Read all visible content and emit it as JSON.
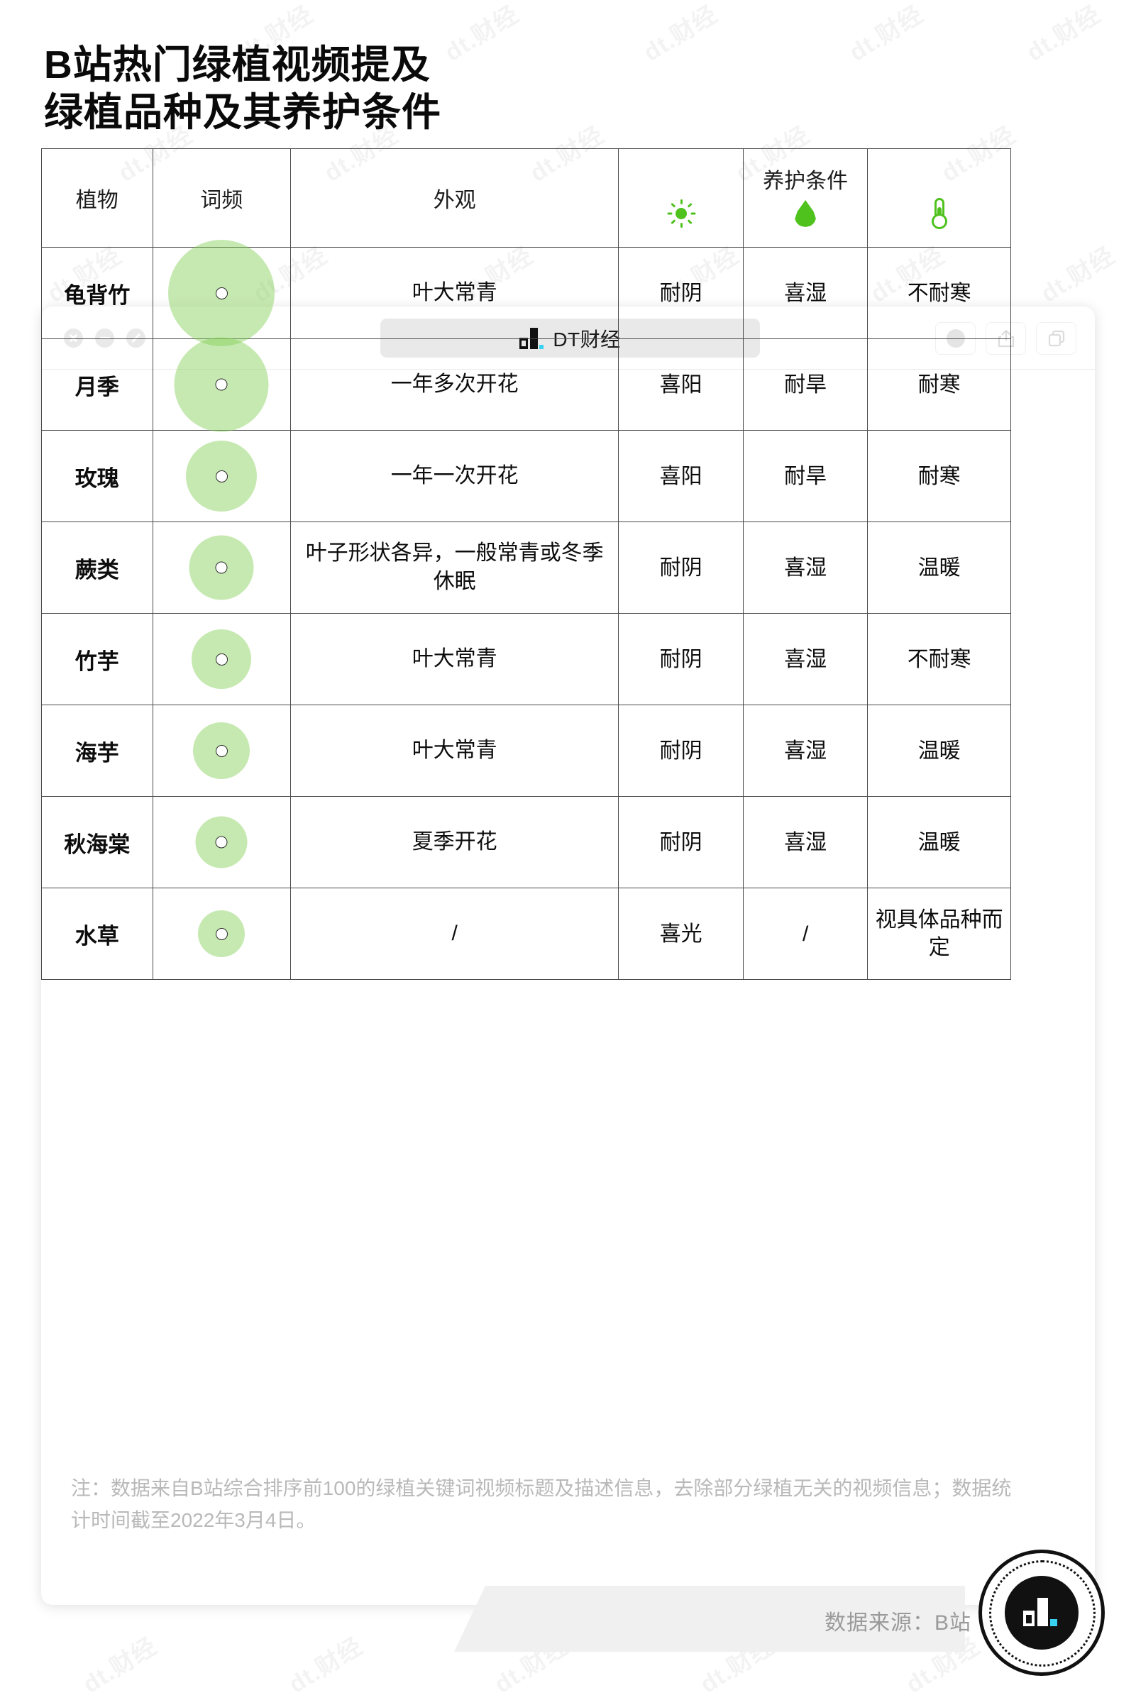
{
  "title": {
    "line1": "B站热门绿植视频提及",
    "line2": "绿植品种及其养护条件"
  },
  "browser": {
    "tab_label": "DT财经",
    "window_controls": [
      "close",
      "minimize",
      "maximize"
    ],
    "right_controls": [
      "record-button",
      "share-button",
      "tabs-button"
    ]
  },
  "table": {
    "headers": {
      "plant": "植物",
      "frequency": "词频",
      "appearance": "外观",
      "care_group": "养护条件",
      "care_sun": "sun-icon",
      "care_water": "water-drop-icon",
      "care_temp": "thermometer-icon"
    },
    "rows": [
      {
        "plant": "龟背竹",
        "freq_size": 150,
        "appearance": "叶大常青",
        "light": "耐阴",
        "water": "喜湿",
        "temp": "不耐寒"
      },
      {
        "plant": "月季",
        "freq_size": 133,
        "appearance": "一年多次开花",
        "light": "喜阳",
        "water": "耐旱",
        "temp": "耐寒"
      },
      {
        "plant": "玫瑰",
        "freq_size": 100,
        "appearance": "一年一次开花",
        "light": "喜阳",
        "water": "耐旱",
        "temp": "耐寒"
      },
      {
        "plant": "蕨类",
        "freq_size": 91,
        "appearance": "叶子形状各异，一般常青或冬季休眠",
        "light": "耐阴",
        "water": "喜湿",
        "temp": "温暖"
      },
      {
        "plant": "竹芋",
        "freq_size": 84,
        "appearance": "叶大常青",
        "light": "耐阴",
        "water": "喜湿",
        "temp": "不耐寒"
      },
      {
        "plant": "海芋",
        "freq_size": 80,
        "appearance": "叶大常青",
        "light": "耐阴",
        "water": "喜湿",
        "temp": "温暖"
      },
      {
        "plant": "秋海棠",
        "freq_size": 73,
        "appearance": "夏季开花",
        "light": "耐阴",
        "water": "喜湿",
        "temp": "温暖"
      },
      {
        "plant": "水草",
        "freq_size": 66,
        "appearance": "/",
        "light": "喜光",
        "water": "/",
        "temp": "视具体品种而定"
      }
    ]
  },
  "footnote": "注：数据来自B站综合排序前100的绿植关键词视频标题及描述信息，去除部分绿植无关的视频信息；数据统计时间截至2022年3月4日。",
  "source": "数据来源：B站",
  "colors": {
    "bubble": "#81ce52",
    "icon_green": "#4fc21e",
    "accent_cyan": "#38d2f0",
    "text": "#0d0d0d",
    "muted": "#b9b9b9"
  },
  "chart_data": {
    "type": "bar",
    "title": "B站热门绿植视频提及绿植品种及其养护条件",
    "categories": [
      "龟背竹",
      "月季",
      "玫瑰",
      "蕨类",
      "竹芋",
      "海芋",
      "秋海棠",
      "水草"
    ],
    "values": [
      150,
      133,
      100,
      91,
      84,
      80,
      73,
      66
    ],
    "xlabel": "",
    "ylabel": "词频",
    "note": "bubble sizes encode relative word frequency (relative units, largest = 龟背竹)"
  },
  "watermarks": [
    "dt.财经",
    "dt.财经",
    "dt.财经",
    "dt.财经",
    "dt.财经",
    "dt.财经",
    "dt.财经",
    "dt.财经",
    "dt.财经",
    "dt.财经",
    "dt.财经",
    "dt.财经",
    "dt.财经",
    "dt.财经",
    "dt.财经",
    "dt.财经",
    "dt.财经",
    "dt.财经",
    "dt.财经",
    "dt.财经",
    "dt.财经",
    "dt.财经",
    "dt.财经",
    "dt.财经",
    "dt.财经",
    "dt.财经",
    "dt.财经",
    "dt.财经",
    "dt.财经",
    "dt.财经",
    "dt.财经",
    "dt.财经",
    "dt.财经",
    "dt.财经",
    "dt.财经",
    "dt.财经"
  ]
}
